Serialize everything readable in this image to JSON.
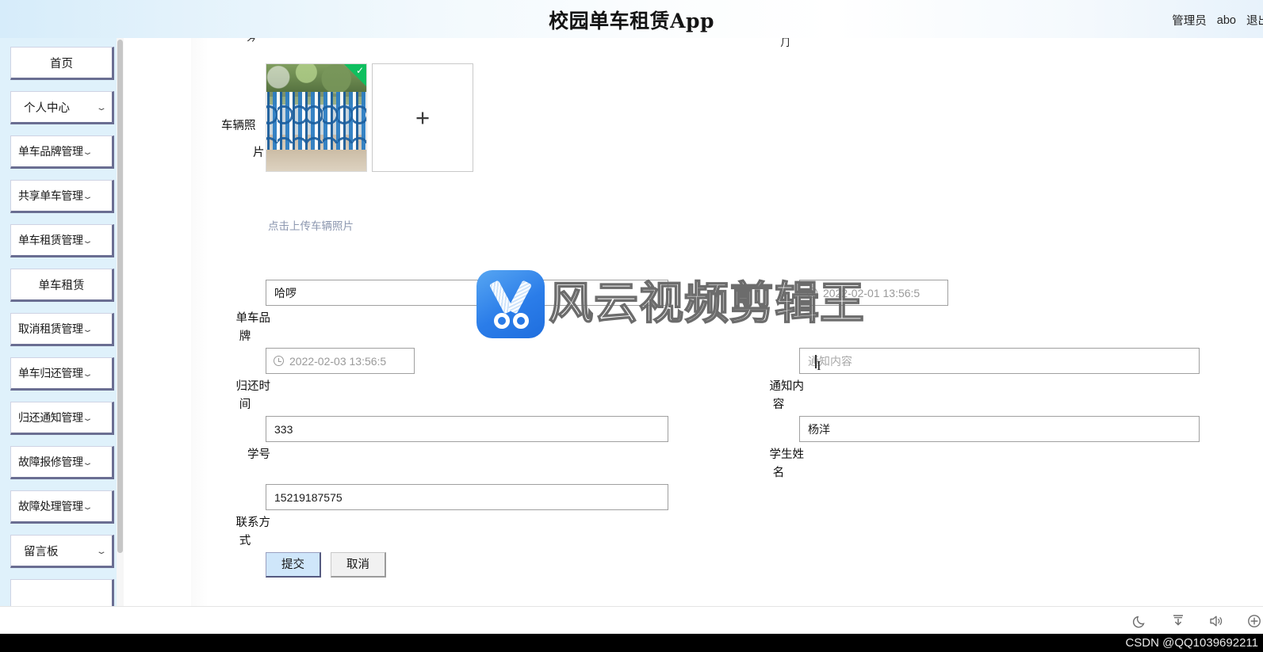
{
  "header": {
    "title": "校园单车租赁App",
    "role": "管理员",
    "username": "abo",
    "logout": "退出"
  },
  "sidebar": {
    "items": [
      {
        "label": "首页",
        "caret": ""
      },
      {
        "label": "个人中心",
        "caret": "⌄"
      },
      {
        "label": "单车品牌管理",
        "caret": "⌄"
      },
      {
        "label": "共享单车管理",
        "caret": "⌄"
      },
      {
        "label": "单车租赁管理",
        "caret": "⌄"
      },
      {
        "label": "单车租赁",
        "caret": ""
      },
      {
        "label": "取消租赁管理",
        "caret": "⌄"
      },
      {
        "label": "单车归还管理",
        "caret": "⌄"
      },
      {
        "label": "归还通知管理",
        "caret": "⌄"
      },
      {
        "label": "故障报修管理",
        "caret": "⌄"
      },
      {
        "label": "故障处理管理",
        "caret": "⌄"
      },
      {
        "label": "留言板",
        "caret": "⌄"
      }
    ]
  },
  "form": {
    "photo": {
      "label_line1": "车辆照",
      "label_line2": "片",
      "add_glyph": "+",
      "upload_hint": "点击上传车辆照片",
      "check_glyph": "✓"
    },
    "fields": {
      "brand": {
        "label_line1": "单车品",
        "label_line2": "牌",
        "value": "哈啰"
      },
      "rent_time": {
        "value": "2022-02-01 13:56:5"
      },
      "return_time": {
        "label_line1": "归还时",
        "label_line2": "间",
        "value": "2022-02-03 13:56:5"
      },
      "notice_content": {
        "label_line1": "通知内",
        "label_line2": "容",
        "value": "",
        "placeholder": "通知内容"
      },
      "student_id": {
        "label_line1": "学号",
        "label_line2": "",
        "value": "333"
      },
      "student_name": {
        "label_line1": "学生姓",
        "label_line2": "名",
        "value": "杨洋"
      },
      "contact": {
        "label_line1": "联系方",
        "label_line2": "式",
        "value": "15219187575"
      }
    },
    "buttons": {
      "submit": "提交",
      "cancel": "取消"
    }
  },
  "watermark": {
    "text": "风云视频剪辑王"
  },
  "footer": {
    "credit": "CSDN @QQ1039692211"
  },
  "cut_glyphs": {
    "a": "⺈",
    "b": "⺆"
  },
  "colors": {
    "header_blue": "#d6ecfa",
    "sidebar_blue": "#dff1fb",
    "menu_shadow": "#6a6e92",
    "primary_button": "#cfe6fa",
    "check_green": "#0fbf5f",
    "hint_text": "#8d98b0",
    "watermark_blue": "#2b7de9"
  }
}
